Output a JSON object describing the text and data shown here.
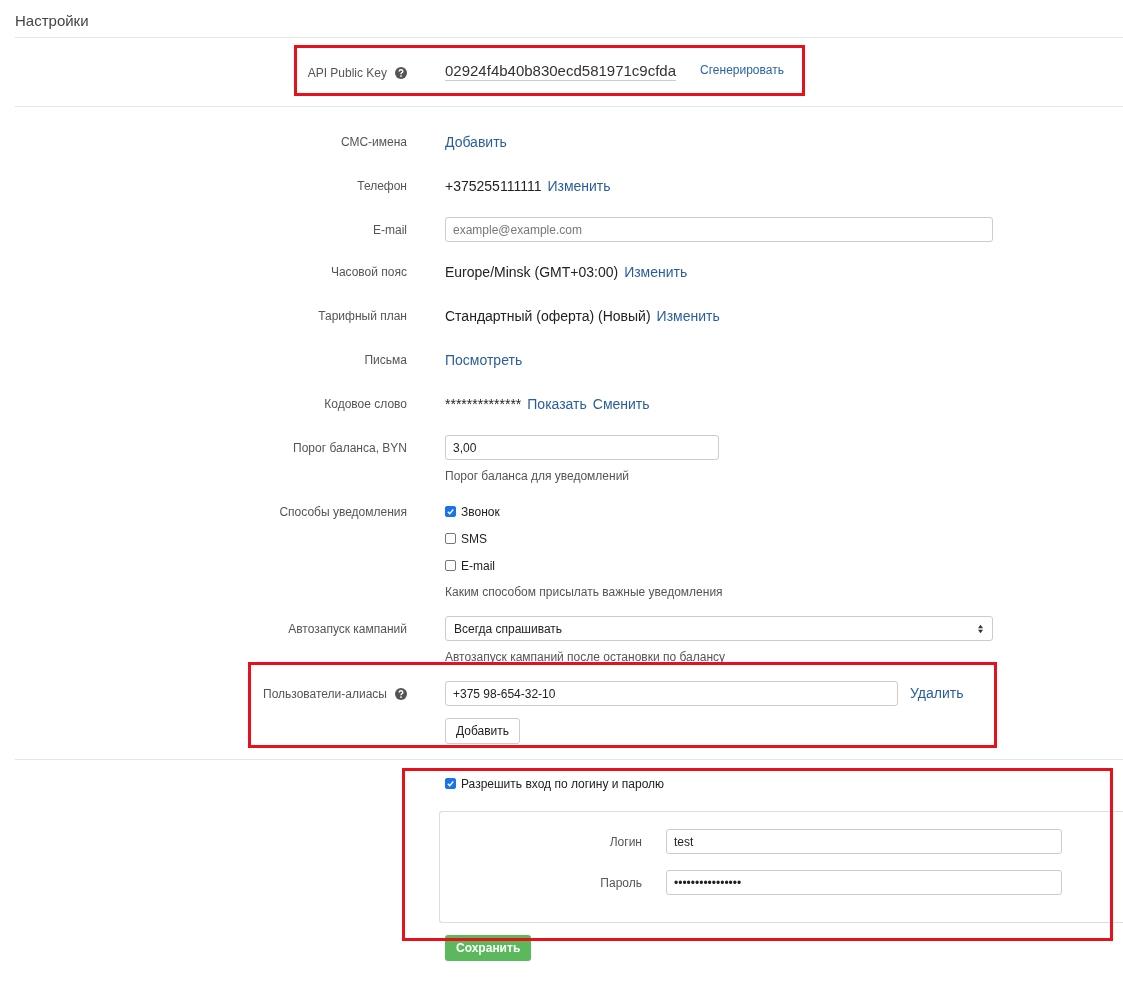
{
  "title": "Настройки",
  "api_key": {
    "label": "API Public Key",
    "has_help": true,
    "value": "02924f4b40b830ecd581971c9cfda",
    "action": "Сгенерировать"
  },
  "fields": [
    {
      "kind": "links",
      "label": "СМС-имена",
      "links": [
        "Добавить"
      ]
    },
    {
      "kind": "text",
      "label": "Телефон",
      "value": "+375255111111",
      "links": [
        "Изменить"
      ]
    },
    {
      "kind": "input",
      "label": "E-mail",
      "placeholder": "example@example.com"
    },
    {
      "kind": "text",
      "label": "Часовой пояс",
      "value": "Europe/Minsk (GMT+03:00)",
      "links": [
        "Изменить"
      ]
    },
    {
      "kind": "text",
      "label": "Тарифный план",
      "value": "Стандартный (оферта) (Новый)",
      "links": [
        "Изменить"
      ]
    },
    {
      "kind": "links",
      "label": "Письма",
      "links": [
        "Посмотреть"
      ]
    },
    {
      "kind": "text",
      "label": "Кодовое слово",
      "value": "**************",
      "links": [
        "Показать",
        "Сменить"
      ]
    },
    {
      "kind": "short-input",
      "label": "Порог баланса, BYN",
      "value": "3,00",
      "help": "Порог баланса для уведомлений"
    },
    {
      "kind": "checkboxes",
      "label": "Способы уведомления",
      "options": [
        {
          "label": "Звонок",
          "checked": true
        },
        {
          "label": "SMS",
          "checked": false
        },
        {
          "label": "E-mail",
          "checked": false
        }
      ],
      "help": "Каким способом присылать важные уведомления"
    },
    {
      "kind": "select",
      "label": "Автозапуск кампаний",
      "value": "Всегда спрашивать",
      "help": "Автозапуск кампаний после остановки по балансу"
    },
    {
      "kind": "aliases",
      "label": "Пользователи-алиасы",
      "has_help": true,
      "items": [
        {
          "value": "+375 98-654-32-10",
          "action": "Удалить"
        }
      ],
      "add": "Добавить"
    }
  ],
  "login": {
    "allow": {
      "label": "Разрешить вход по логину и паролю",
      "checked": true
    },
    "fields": [
      {
        "label": "Логин",
        "value": "test"
      },
      {
        "label": "Пароль",
        "value": "••••••••••••••••"
      }
    ]
  },
  "save": "Сохранить"
}
